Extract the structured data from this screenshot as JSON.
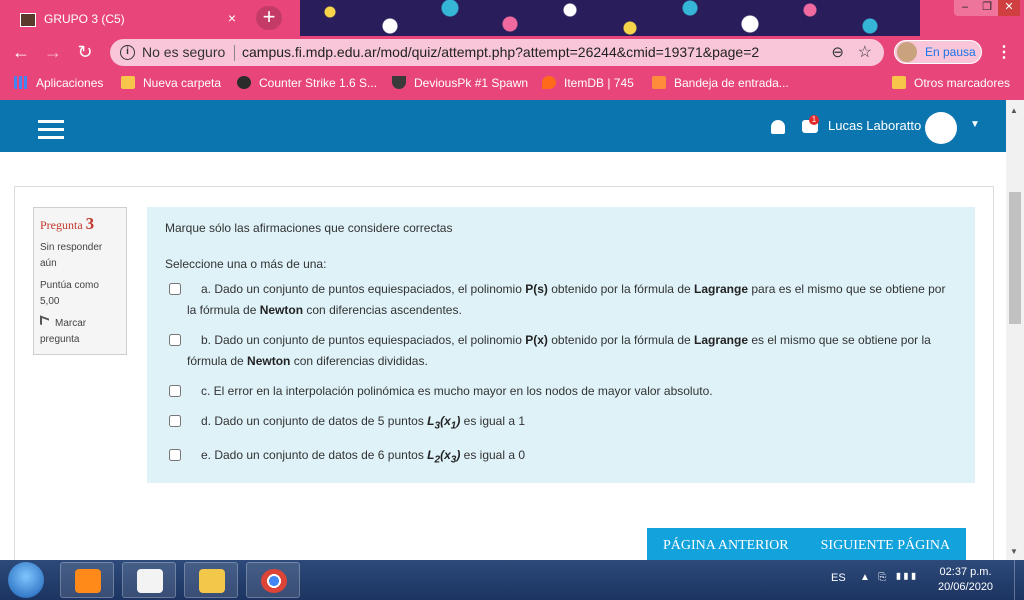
{
  "browser": {
    "tab_title": "GRUPO 3 (C5)",
    "tab_close": "×",
    "new_tab": "+",
    "url_security": "No es seguro",
    "url": "campus.fi.mdp.edu.ar/mod/quiz/attempt.php?attempt=26244&cmid=19371&page=2",
    "profile_label": "En pausa",
    "accent": "#e8467a"
  },
  "bookmarks": [
    {
      "label": "Aplicaciones",
      "icon": "apps-grid-icon"
    },
    {
      "label": "Nueva carpeta",
      "icon": "folder-icon"
    },
    {
      "label": "Counter Strike 1.6 S...",
      "icon": "cs-icon"
    },
    {
      "label": "DeviousPk #1 Spawn",
      "icon": "shield-icon"
    },
    {
      "label": "ItemDB | 745",
      "icon": "fire-icon"
    },
    {
      "label": "Bandeja de entrada...",
      "icon": "foro-icon"
    },
    {
      "label": "Otros marcadores",
      "icon": "folder-icon"
    }
  ],
  "moodle": {
    "username": "Lucas Laboratto",
    "notification_count": "1",
    "header_color": "#0b75b0"
  },
  "question": {
    "label": "Pregunta",
    "number": "3",
    "status": "Sin responder aún",
    "points": "Puntúa como 5,00",
    "flag": "Marcar pregunta",
    "text": "Marque sólo las afirmaciones que considere correctas",
    "prompt": "Seleccione una o más de una:",
    "answers": {
      "a": {
        "p1": "a. Dado un conjunto de puntos equiespaciados, el polinomio ",
        "b1": "P(s)",
        "p2": "  obtenido por la fórmula de ",
        "b2": "Lagrange",
        "p3": " para es el mismo que se obtiene por la fórmula de ",
        "b3": "Newton",
        "p4": " con diferencias ascendentes."
      },
      "b": {
        "p1": "b. Dado un conjunto de puntos equiespaciados, el polinomio ",
        "b1": "P(x)",
        "p2": "  obtenido por la fórmula de ",
        "b2": "Lagrange",
        "p3": " es el mismo que se obtiene por la fórmula de ",
        "b3": "Newton",
        "p4": " con diferencias divididas."
      },
      "c": {
        "p1": "c. El error en la interpolación polinómica es mucho mayor en los nodos de mayor valor absoluto."
      },
      "d": {
        "p1": "d. Dado un conjunto de datos de 5 puntos ",
        "m1": "L",
        "s1": "3",
        "m2": "(x",
        "s2": "1",
        "m3": ")",
        "p2": " es igual a 1"
      },
      "e": {
        "p1": "e. Dado un conjunto de datos de 6 puntos ",
        "m1": "L",
        "s1": "2",
        "m2": "(x",
        "s2": "3",
        "m3": ")",
        "p2": " es igual a 0"
      }
    }
  },
  "nav_buttons": {
    "prev": "PÁGINA ANTERIOR",
    "next": "SIGUIENTE PÁGINA"
  },
  "taskbar": {
    "language": "ES",
    "time": "02:37 p.m.",
    "date": "20/06/2020"
  }
}
